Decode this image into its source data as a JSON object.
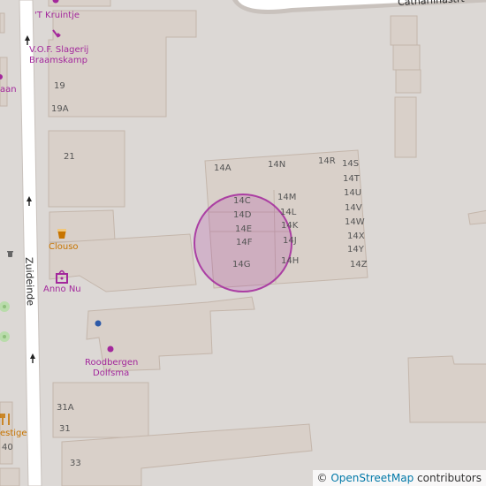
{
  "map": {
    "street_top": "Cathariinastrt",
    "street_left": "Zuideinde",
    "building_numbers": [
      "19",
      "19A",
      "21",
      "31A",
      "31",
      "33",
      "40",
      "14A",
      "14N",
      "14R",
      "14S",
      "14T",
      "14U",
      "14V",
      "14W",
      "14X",
      "14Y",
      "14Z",
      "14C",
      "14D",
      "14E",
      "14F",
      "14G",
      "14M",
      "14L",
      "14K",
      "14J",
      "14H"
    ],
    "pois": {
      "kruintje": "'T Kruintje",
      "slagerij_line1": "V.O.F. Slagerij",
      "slagerij_line2": "Braamskamp",
      "clouso": "Clouso",
      "anno_nu": "Anno Nu",
      "roodbergen_line1": "Roodbergen",
      "roodbergen_line2": "Dolfsma",
      "left_edge_top": "aan",
      "left_edge_bottom": "estige"
    },
    "icons": {
      "butcher": "knife-icon",
      "bar": "glass-icon",
      "shop": "shopping-bag-icon",
      "restaurant": "fork-knife-icon",
      "waste": "waste-basket-icon",
      "tree": "tree-icon",
      "poi_dot": "dot-icon"
    },
    "colors": {
      "background": "#dcd8d5",
      "building": "#d9d0c9",
      "building_outline": "#c4b6ab",
      "road": "#ffffff",
      "marker_fill": "#a3289c",
      "poi_text": "#a3289c",
      "food_icon": "#c77400"
    },
    "attribution": {
      "symbol": "©",
      "link": "OpenStreetMap",
      "text": " contributors"
    }
  }
}
